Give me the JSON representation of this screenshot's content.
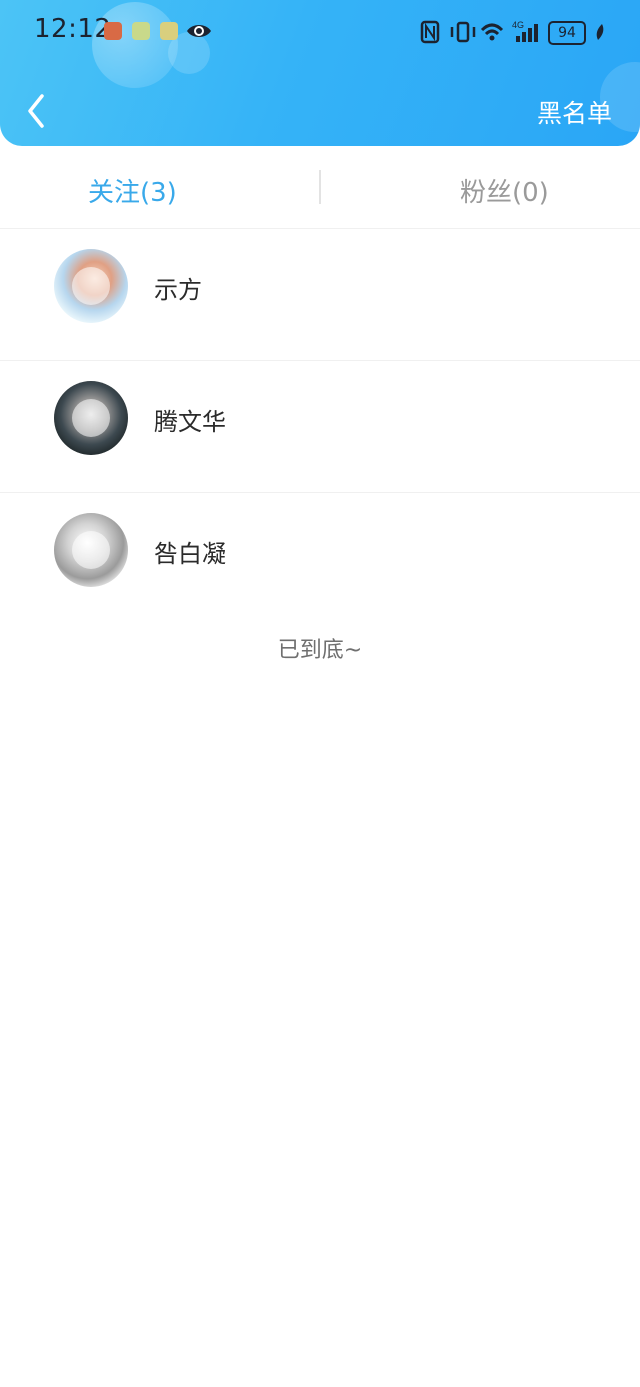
{
  "status_bar": {
    "time": "12:12",
    "battery": "94"
  },
  "header": {
    "right_action": "黑名单"
  },
  "tabs": [
    {
      "label": "关注(3)"
    },
    {
      "label": "粉丝(0)"
    }
  ],
  "following": [
    {
      "name": "示方"
    },
    {
      "name": "腾文华"
    },
    {
      "name": "咎白凝"
    }
  ],
  "end_of_list": "已到底~",
  "colors": {
    "header_start": "#4cc4f6",
    "header_end": "#2aa6f6",
    "active_tab": "#39a9ea",
    "inactive_tab": "#9a9a9a"
  }
}
